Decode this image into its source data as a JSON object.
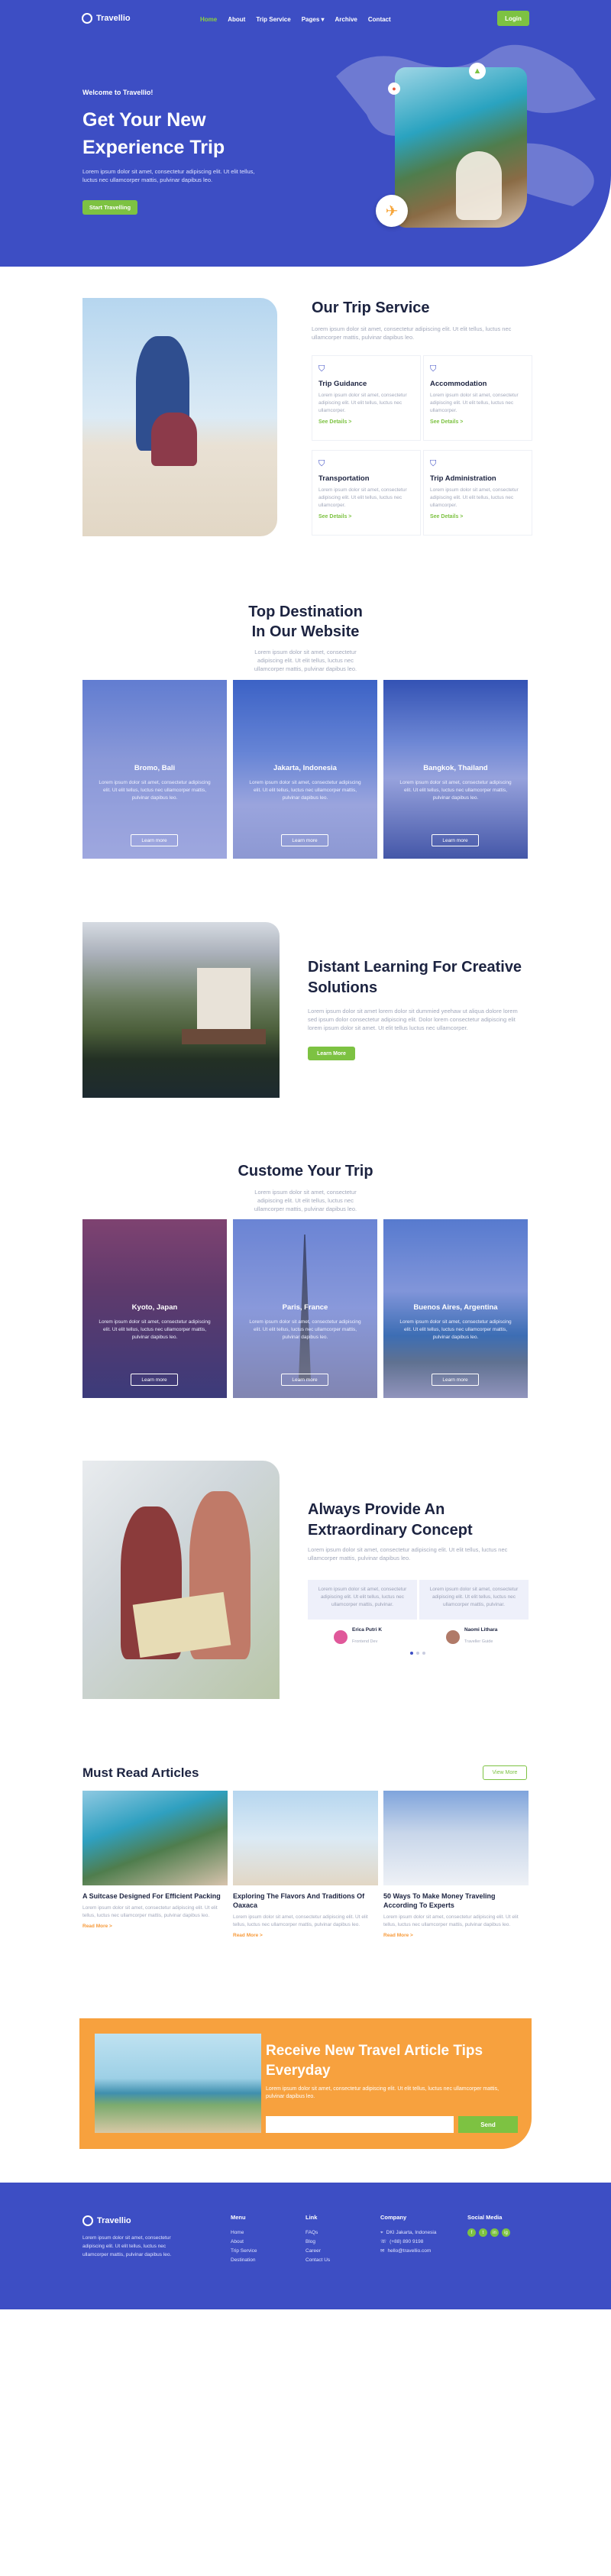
{
  "colors": {
    "primary": "#3d4ec4",
    "accent": "#7dc242",
    "orange": "#f7a13e"
  },
  "nav": {
    "brand": "Travellio",
    "items": [
      "Home",
      "About",
      "Trip Service",
      "Pages",
      "Archive",
      "Contact"
    ],
    "login": "Login"
  },
  "hero": {
    "kicker": "Welcome to Travellio!",
    "title": "Get Your New Experience Trip",
    "text": "Lorem ipsum dolor sit amet, consectetur adipiscing elit. Ut elit tellus, luctus nec ullamcorper mattis, pulvinar dapibus leo.",
    "button": "Start Travelling"
  },
  "service": {
    "title": "Our Trip Service",
    "text": "Lorem ipsum dolor sit amet, consectetur adipiscing elit. Ut elit tellus, luctus nec ullamcorper mattis, pulvinar dapibus leo.",
    "cards": [
      {
        "title": "Trip Guidance",
        "text": "Lorem ipsum dolor sit amet, consectetur adipiscing elit. Ut elit tellus, luctus nec ullamcorper.",
        "link": "See Details >"
      },
      {
        "title": "Accommodation",
        "text": "Lorem ipsum dolor sit amet, consectetur adipiscing elit. Ut elit tellus, luctus nec ullamcorper.",
        "link": "See Details >"
      },
      {
        "title": "Transportation",
        "text": "Lorem ipsum dolor sit amet, consectetur adipiscing elit. Ut elit tellus, luctus nec ullamcorper.",
        "link": "See Details >"
      },
      {
        "title": "Trip Administration",
        "text": "Lorem ipsum dolor sit amet, consectetur adipiscing elit. Ut elit tellus, luctus nec ullamcorper.",
        "link": "See Details >"
      }
    ]
  },
  "destinations": {
    "title_line1": "Top Destination",
    "title_line2": "In Our Website",
    "text": "Lorem ipsum dolor sit amet, consectetur adipiscing elit. Ut elit tellus, luctus nec ullamcorper mattis, pulvinar dapibus leo.",
    "items": [
      {
        "name": "Bromo, Bali",
        "text": "Lorem ipsum dolor sit amet, consectetur adipiscing elit. Ut elit tellus, luctus nec ullamcorper mattis, pulvinar dapibus leo.",
        "button": "Learn more"
      },
      {
        "name": "Jakarta, Indonesia",
        "text": "Lorem ipsum dolor sit amet, consectetur adipiscing elit. Ut elit tellus, luctus nec ullamcorper mattis, pulvinar dapibus leo.",
        "button": "Learn more"
      },
      {
        "name": "Bangkok, Thailand",
        "text": "Lorem ipsum dolor sit amet, consectetur adipiscing elit. Ut elit tellus, luctus nec ullamcorper mattis, pulvinar dapibus leo.",
        "button": "Learn more"
      }
    ]
  },
  "distant": {
    "title": "Distant Learning For Creative Solutions",
    "text": "Lorem ipsum dolor sit amet lorem dolor sit dummied yeehaw ut aliqua dolore lorem sed ipsum dolor consectetur adipiscing elit. Dolor lorem consectetur adipiscing elit lorem ipsum dolor sit amet. Ut elit tellus luctus nec ullamcorper.",
    "button": "Learn More"
  },
  "custom": {
    "title": "Custome Your Trip",
    "text": "Lorem ipsum dolor sit amet, consectetur adipiscing elit. Ut elit tellus, luctus nec ullamcorper mattis, pulvinar dapibus leo.",
    "items": [
      {
        "name": "Kyoto, Japan",
        "text": "Lorem ipsum dolor sit amet, consectetur adipiscing elit. Ut elit tellus, luctus nec ullamcorper mattis, pulvinar dapibus leo.",
        "button": "Learn more"
      },
      {
        "name": "Paris, France",
        "text": "Lorem ipsum dolor sit amet, consectetur adipiscing elit. Ut elit tellus, luctus nec ullamcorper mattis, pulvinar dapibus leo.",
        "button": "Learn more"
      },
      {
        "name": "Buenos Aires, Argentina",
        "text": "Lorem ipsum dolor sit amet, consectetur adipiscing elit. Ut elit tellus, luctus nec ullamcorper mattis, pulvinar dapibus leo.",
        "button": "Learn more"
      }
    ]
  },
  "always": {
    "title": "Always Provide An Extraordinary Concept",
    "text": "Lorem ipsum dolor sit amet, consectetur adipiscing elit. Ut elit tellus, luctus nec ullamcorper mattis, pulvinar dapibus leo.",
    "testimonials": [
      {
        "quote": "Lorem ipsum dolor sit amet, consectetur adipiscing elit. Ut elit tellus, luctus nec ullamcorper mattis, pulvinar.",
        "name": "Erica Putri K",
        "role": "Frontend Dev"
      },
      {
        "quote": "Lorem ipsum dolor sit amet, consectetur adipiscing elit. Ut elit tellus, luctus nec ullamcorper mattis, pulvinar.",
        "name": "Naomi Lithara",
        "role": "Traveller Guide"
      }
    ]
  },
  "articles": {
    "title": "Must Read Articles",
    "view_more": "View More",
    "items": [
      {
        "title": "A Suitcase Designed For Efficient Packing",
        "text": "Lorem ipsum dolor sit amet, consectetur adipiscing elit. Ut elit tellus, luctus nec ullamcorper mattis, pulvinar dapibus leo.",
        "link": "Read More >"
      },
      {
        "title": "Exploring The Flavors And Traditions Of Oaxaca",
        "text": "Lorem ipsum dolor sit amet, consectetur adipiscing elit. Ut elit tellus, luctus nec ullamcorper mattis, pulvinar dapibus leo.",
        "link": "Read More >"
      },
      {
        "title": "50 Ways To Make Money Traveling According To Experts",
        "text": "Lorem ipsum dolor sit amet, consectetur adipiscing elit. Ut elit tellus, luctus nec ullamcorper mattis, pulvinar dapibus leo.",
        "link": "Read More >"
      }
    ]
  },
  "newsletter": {
    "title": "Receive New Travel Article Tips Everyday",
    "text": "Lorem ipsum dolor sit amet, consectetur adipiscing elit. Ut elit tellus, luctus nec ullamcorper mattis, pulvinar dapibus leo.",
    "placeholder": "",
    "button": "Send"
  },
  "footer": {
    "brand": "Travellio",
    "about": "Lorem ipsum dolor sit amet, consectetur adipiscing elit. Ut elit tellus, luctus nec ullamcorper mattis, pulvinar dapibus leo.",
    "menu_title": "Menu",
    "menu": [
      "Home",
      "About",
      "Trip Service",
      "Destination"
    ],
    "link_title": "Link",
    "links": [
      "FAQs",
      "Blog",
      "Career",
      "Contact Us"
    ],
    "company_title": "Company",
    "company": [
      "DKI Jakarta, Indonesia",
      "(+88) 890 9198",
      "hello@travellio.com"
    ],
    "social_title": "Social Media",
    "social": [
      "f",
      "t",
      "in",
      "ig"
    ]
  }
}
